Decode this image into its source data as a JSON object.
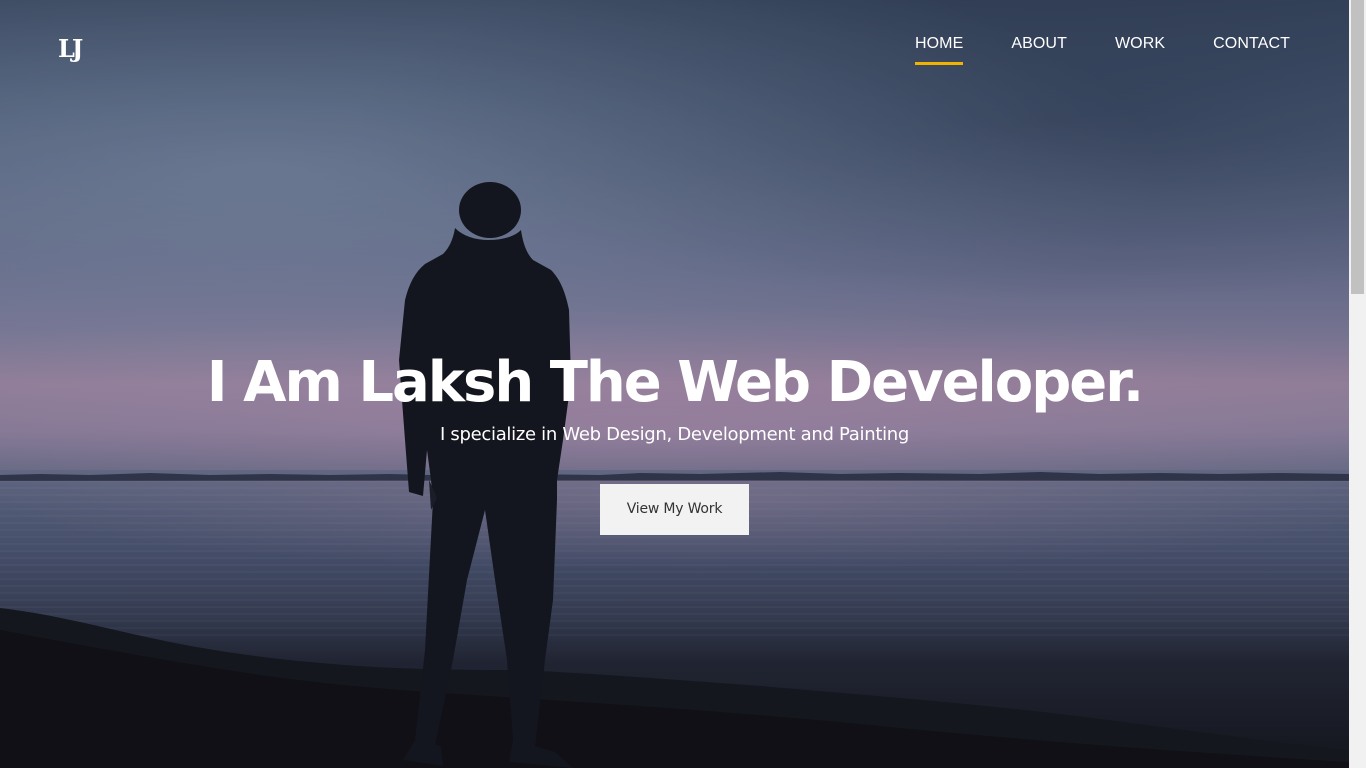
{
  "brand": {
    "logo_text": "LJ"
  },
  "nav": {
    "items": [
      {
        "label": "HOME",
        "active": true
      },
      {
        "label": "ABOUT",
        "active": false
      },
      {
        "label": "WORK",
        "active": false
      },
      {
        "label": "CONTACT",
        "active": false
      }
    ]
  },
  "hero": {
    "headline": "I Am Laksh The Web Developer.",
    "tagline": "I specialize in Web Design, Development and Painting",
    "cta_label": "View My Work",
    "background": "dusk lake with silhouetted man"
  },
  "colors": {
    "accent": "#f0b400",
    "button_bg": "#f2f2f2",
    "button_text": "#333333",
    "text": "#ffffff"
  }
}
